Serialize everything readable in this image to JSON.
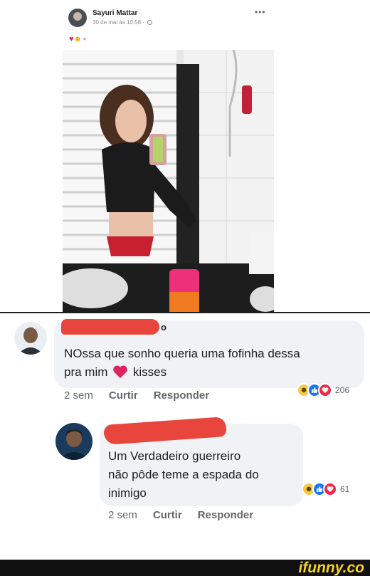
{
  "post": {
    "author": "Sayuri Mattar",
    "timestamp": "30 de mai às 10:58 · ",
    "more": "•••",
    "emojis": {
      "heart": "♥",
      "blush": "☻",
      "sparkle": "✦"
    }
  },
  "comments": [
    {
      "author_suffix": "o",
      "text_line1": "NOssa que sonho queria uma fofinha dessa",
      "text_line2": "pra mim",
      "text_after_heart": " kisses",
      "time": "2 sem",
      "like_label": "Curtir",
      "reply_label": "Responder",
      "reaction_count": "206"
    },
    {
      "text_lines": [
        "Um Verdadeiro guerreiro",
        "não pôde teme a espada do",
        "inimigo"
      ],
      "time": "2 sem",
      "like_label": "Curtir",
      "reply_label": "Responder",
      "reaction_count": "61"
    }
  ],
  "reaction_icons": {
    "haha": "☻",
    "like": "👍",
    "love": "♥"
  },
  "footer": {
    "logo": "ifunny.co"
  },
  "colors": {
    "accent_like": "#1877f2",
    "love": "#f02849",
    "haha": "#f7c945",
    "redaction": "#e8453c",
    "logo": "#f7d21e"
  }
}
